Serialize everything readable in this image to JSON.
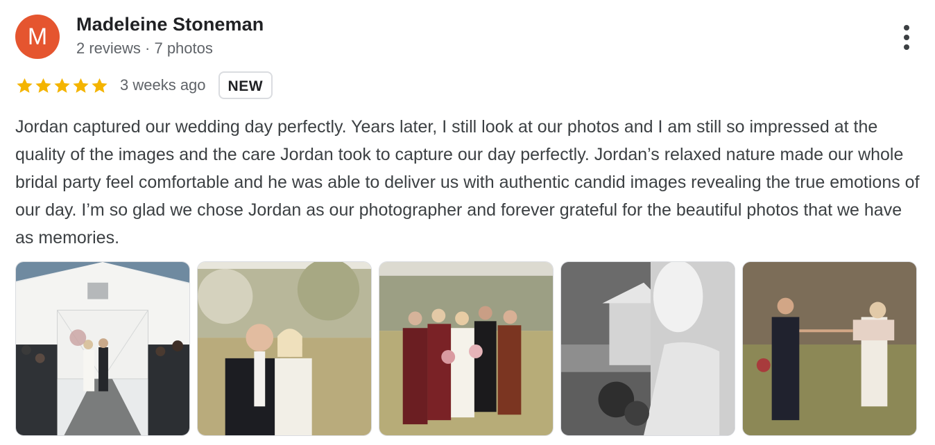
{
  "reviewer": {
    "avatar_letter": "M",
    "avatar_color": "#e5552f",
    "name": "Madeleine Stoneman",
    "meta": "2 reviews · 7 photos"
  },
  "rating": {
    "stars": 5,
    "star_color": "#f4b400",
    "time": "3 weeks ago",
    "badge": "NEW"
  },
  "review_text": "Jordan captured our wedding day perfectly. Years later, I still look at our photos and I am still so impressed at the quality of the images and the care Jordan took to capture our day perfectly. Jordan’s relaxed nature made our whole bridal party feel comfortable and he was able to deliver us with authentic candid images revealing the true emotions of our day. I’m so glad we chose Jordan as our photographer and forever grateful for the beautiful photos that we have as memories.",
  "icons": {
    "more_menu": "more-vert-icon",
    "star": "star-icon"
  },
  "photos": [
    {
      "subject": "barn-ceremony-exit"
    },
    {
      "subject": "couple-walking-field"
    },
    {
      "subject": "bridal-party-group"
    },
    {
      "subject": "bride-black-and-white"
    },
    {
      "subject": "couple-holding-hands"
    }
  ]
}
